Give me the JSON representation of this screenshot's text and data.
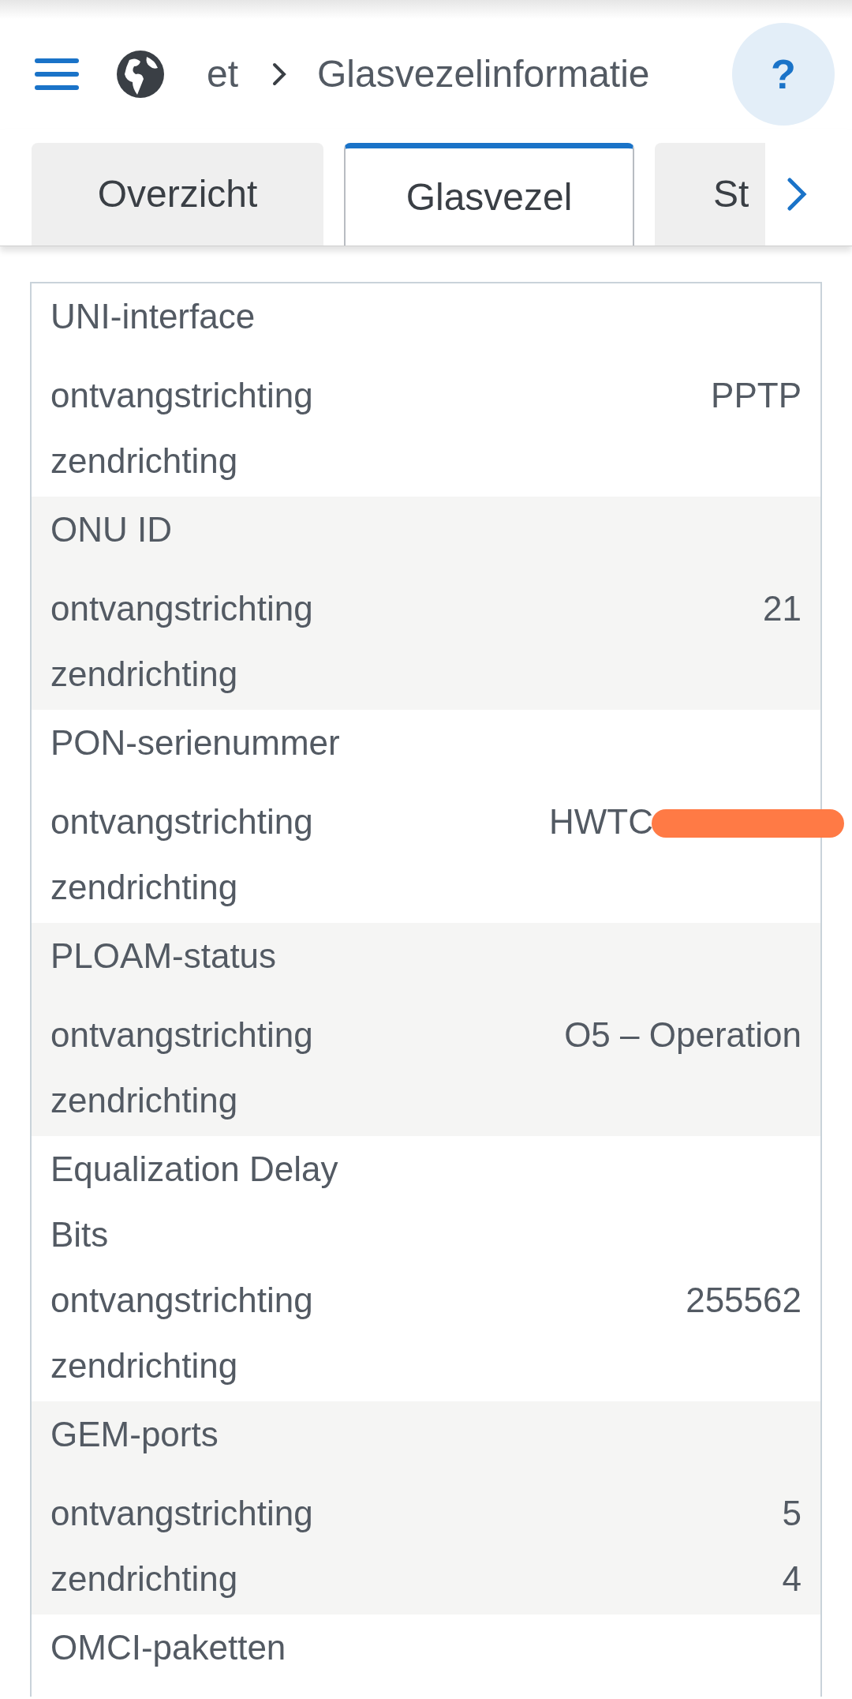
{
  "header": {
    "breadcrumb": [
      "et",
      "Glasvezelinformatie"
    ],
    "help": "?"
  },
  "tabs": [
    {
      "label": "Overzicht",
      "selected": false
    },
    {
      "label": "Glasvezel",
      "selected": true
    },
    {
      "label": "St",
      "selected": false
    }
  ],
  "sections": [
    {
      "title": "UNI-interface",
      "rows": [
        {
          "label": "ontvangstrichting",
          "value": "PPTP"
        },
        {
          "label": "zendrichting"
        }
      ]
    },
    {
      "title": "ONU ID",
      "rows": [
        {
          "label": "ontvangstrichting",
          "value": "21"
        },
        {
          "label": "zendrichting"
        }
      ]
    },
    {
      "title": "PON-serienummer",
      "rows": [
        {
          "label": "ontvangstrichting",
          "value": "HWTC",
          "redacted": true
        },
        {
          "label": "zendrichting"
        }
      ]
    },
    {
      "title": "PLOAM-status",
      "rows": [
        {
          "label": "ontvangstrichting",
          "value": "O5 – Operation"
        },
        {
          "label": "zendrichting"
        }
      ]
    },
    {
      "title": "Equalization Delay Bits",
      "rows": [
        {
          "label": "ontvangstrichting",
          "value": "255562"
        },
        {
          "label": "zendrichting"
        }
      ]
    },
    {
      "title": "GEM-ports",
      "rows": [
        {
          "label": "ontvangstrichting",
          "value": "5"
        },
        {
          "label": "zendrichting",
          "value": "4"
        }
      ]
    },
    {
      "title": "OMCI-paketten"
    }
  ]
}
